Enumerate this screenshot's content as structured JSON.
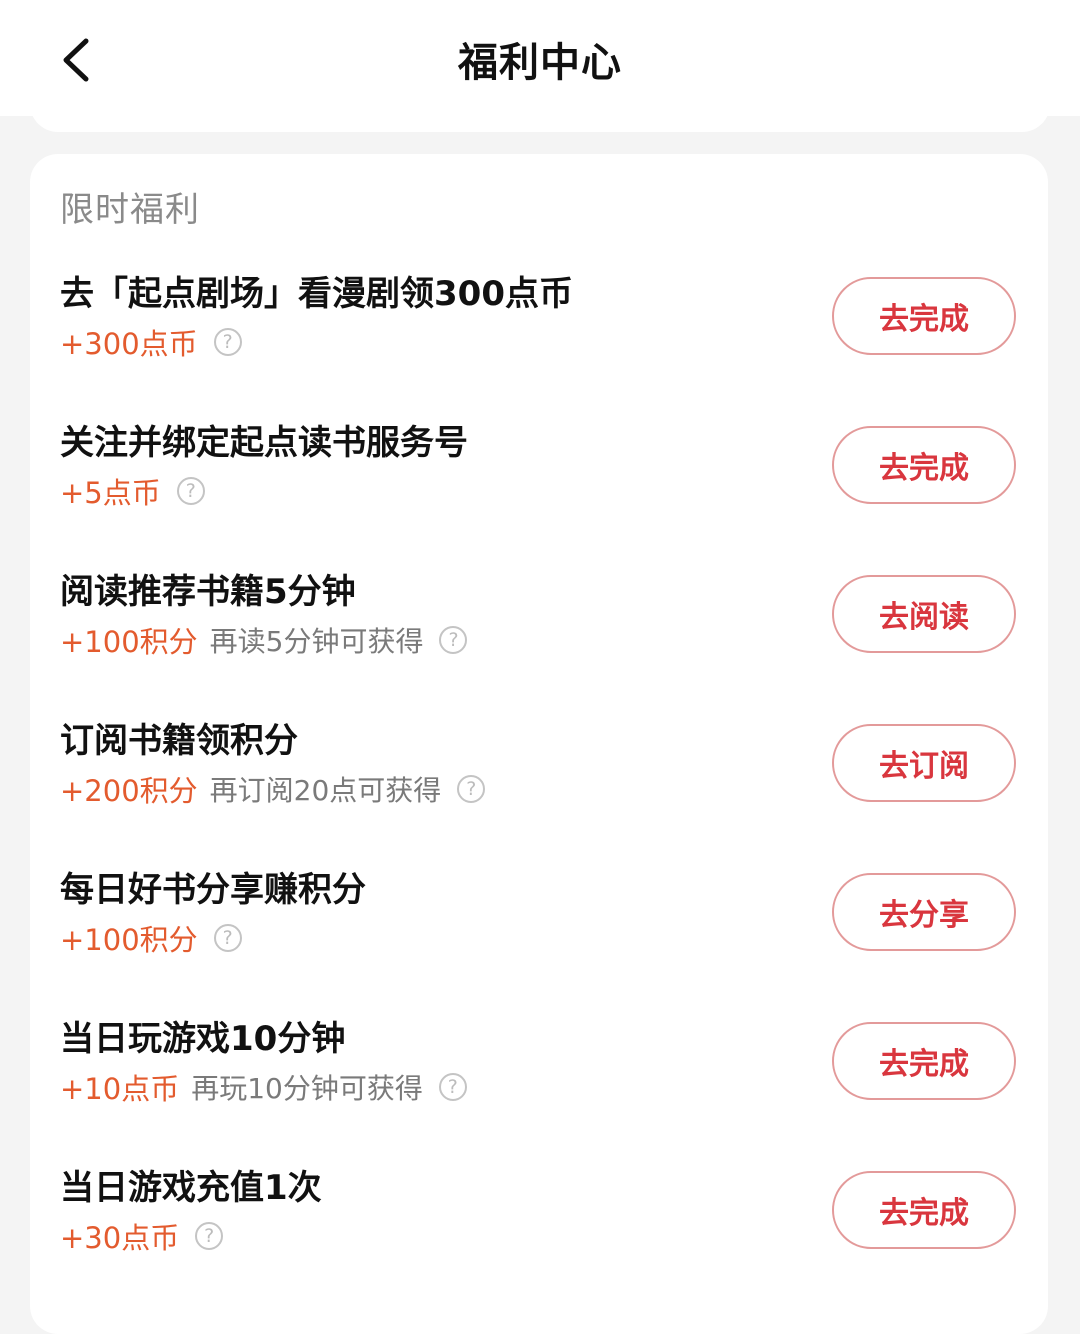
{
  "header": {
    "title": "福利中心",
    "back_icon": "chevron-left-icon"
  },
  "section": {
    "title": "限时福利"
  },
  "colors": {
    "accent_reward": "#e35b2e",
    "button_text": "#d9363e",
    "button_border": "#e39a9a"
  },
  "tasks": [
    {
      "title": "去「起点剧场」看漫剧领300点币",
      "reward": "+300点币",
      "hint": "",
      "button": "去完成"
    },
    {
      "title": "关注并绑定起点读书服务号",
      "reward": "+5点币",
      "hint": "",
      "button": "去完成"
    },
    {
      "title": "阅读推荐书籍5分钟",
      "reward": "+100积分",
      "hint": "再读5分钟可获得",
      "button": "去阅读"
    },
    {
      "title": "订阅书籍领积分",
      "reward": "+200积分",
      "hint": "再订阅20点可获得",
      "button": "去订阅"
    },
    {
      "title": "每日好书分享赚积分",
      "reward": "+100积分",
      "hint": "",
      "button": "去分享"
    },
    {
      "title": "当日玩游戏10分钟",
      "reward": "+10点币",
      "hint": "再玩10分钟可获得",
      "button": "去完成"
    },
    {
      "title": "当日游戏充值1次",
      "reward": "+30点币",
      "hint": "",
      "button": "去完成"
    }
  ]
}
